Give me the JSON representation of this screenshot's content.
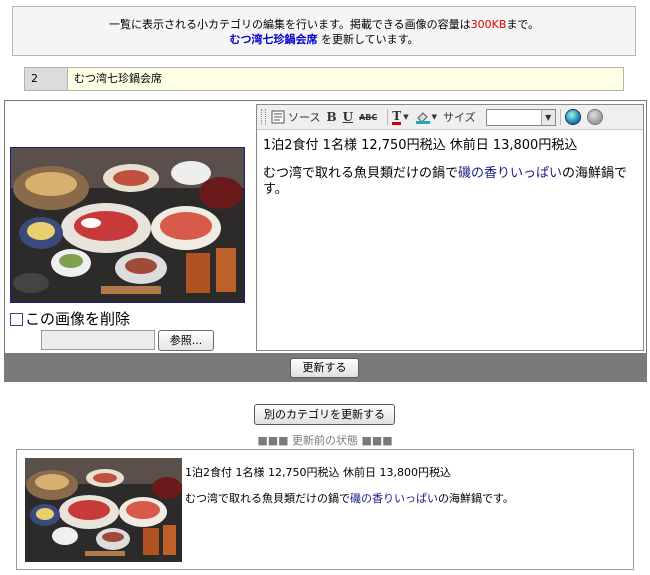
{
  "notice": {
    "line1_prefix": "一覧に表示される小カテゴリの編集を行います。掲載できる画像の容量は",
    "capacity": "300KB",
    "line1_suffix": "まで。",
    "category_name": "むつ湾七珍鍋会席",
    "line2_suffix": " を更新しています。"
  },
  "category": {
    "number": "2",
    "name": "むつ湾七珍鍋会席"
  },
  "image": {
    "delete_label": "この画像を削除",
    "browse_label": "参照..."
  },
  "editor": {
    "toolbar": {
      "source": "ソース",
      "bold": "B",
      "underline": "U",
      "strike": "ABC",
      "text_color": "T",
      "size_label": "サイズ",
      "size_value": ""
    },
    "line1": "1泊2食付 1名様 12,750円税込 休前日 13,800円税込",
    "line2_prefix": "むつ湾で取れる魚貝類だけの鍋で",
    "line2_highlight": "磯の香りいっぱい",
    "line2_suffix": "の海鮮鍋です。"
  },
  "buttons": {
    "update": "更新する",
    "other_category": "別のカテゴリを更新する"
  },
  "preview": {
    "label": "■■■ 更新前の状態 ■■■",
    "line1": "1泊2食付 1名様 12,750円税込 休前日 13,800円税込",
    "line2_prefix": "むつ湾で取れる魚貝類だけの鍋で",
    "line2_highlight": "磯の香りいっぱい",
    "line2_suffix": "の海鮮鍋です。"
  },
  "colors": {
    "accent_red": "#e00000",
    "link_blue": "#0000cc",
    "bar_gray": "#7a7a7a"
  }
}
